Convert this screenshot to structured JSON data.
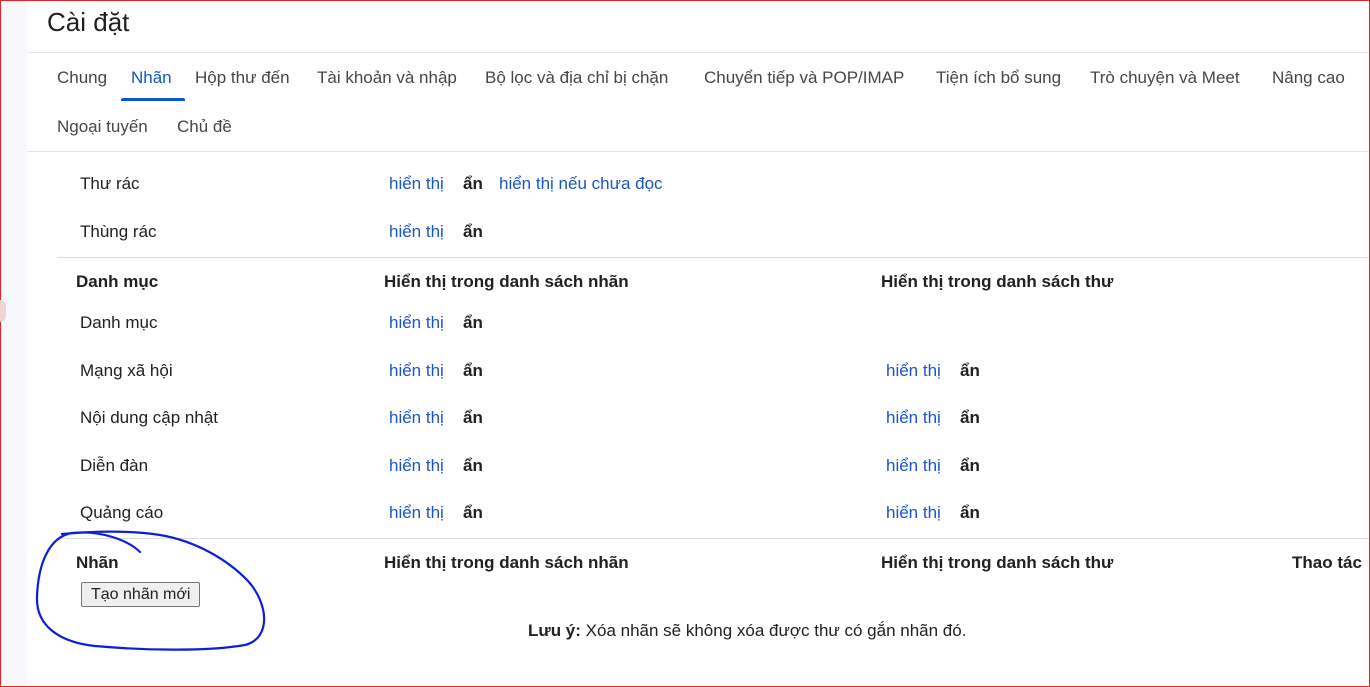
{
  "page": {
    "title": "Cài đặt"
  },
  "tabs": [
    {
      "label": "Chung"
    },
    {
      "label": "Nhãn"
    },
    {
      "label": "Hộp thư đến"
    },
    {
      "label": "Tài khoản và nhập"
    },
    {
      "label": "Bộ lọc và địa chỉ bị chặn"
    },
    {
      "label": "Chuyển tiếp và POP/IMAP"
    },
    {
      "label": "Tiện ích bổ sung"
    },
    {
      "label": "Trò chuyện và Meet"
    },
    {
      "label": "Nâng cao"
    },
    {
      "label": "Ngoại tuyến"
    },
    {
      "label": "Chủ đề"
    }
  ],
  "active_tab": "Nhãn",
  "system_labels": [
    {
      "name": "Thư rác",
      "show": "hiển thị",
      "hide": "ẩn",
      "show_if_unread": "hiển thị nếu chưa đọc"
    },
    {
      "name": "Thùng rác",
      "show": "hiển thị",
      "hide": "ẩn"
    }
  ],
  "categories": {
    "header": {
      "name": "Danh mục",
      "label_list": "Hiển thị trong danh sách nhãn",
      "message_list": "Hiển thị trong danh sách thư"
    },
    "rows": [
      {
        "name": "Danh mục",
        "label_show": "hiển thị",
        "label_hide": "ẩn"
      },
      {
        "name": "Mạng xã hội",
        "label_show": "hiển thị",
        "label_hide": "ẩn",
        "msg_show": "hiển thị",
        "msg_hide": "ẩn"
      },
      {
        "name": "Nội dung cập nhật",
        "label_show": "hiển thị",
        "label_hide": "ẩn",
        "msg_show": "hiển thị",
        "msg_hide": "ẩn"
      },
      {
        "name": "Diễn đàn",
        "label_show": "hiển thị",
        "label_hide": "ẩn",
        "msg_show": "hiển thị",
        "msg_hide": "ẩn"
      },
      {
        "name": "Quảng cáo",
        "label_show": "hiển thị",
        "label_hide": "ẩn",
        "msg_show": "hiển thị",
        "msg_hide": "ẩn"
      }
    ]
  },
  "labels": {
    "header": {
      "name": "Nhãn",
      "label_list": "Hiển thị trong danh sách nhãn",
      "message_list": "Hiển thị trong danh sách thư",
      "actions": "Thao tác"
    },
    "create_button": "Tạo nhãn mới",
    "note_bold": "Lưu ý:",
    "note_text": " Xóa nhãn sẽ không xóa được thư có gắn nhãn đó."
  },
  "colors": {
    "link": "#1a56c6",
    "active_tab": "#0b57d0",
    "frame_border": "#e0262d",
    "annotation": "#0d1fd6"
  }
}
